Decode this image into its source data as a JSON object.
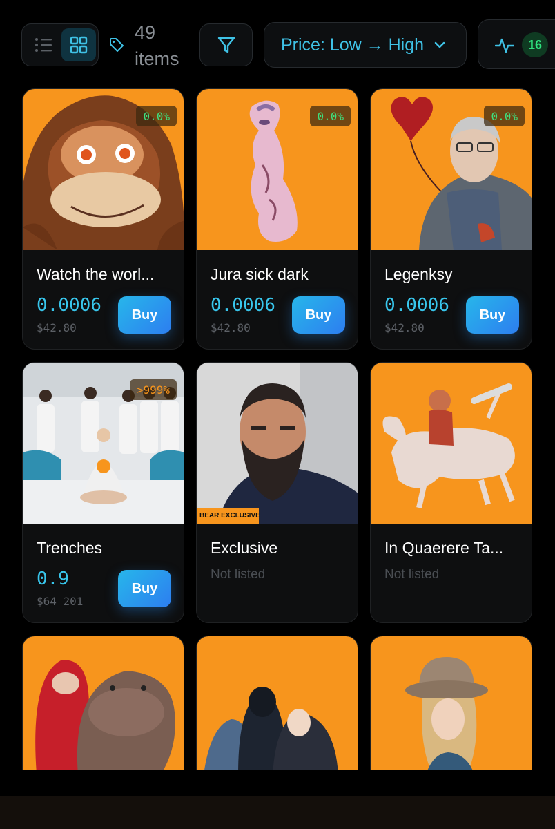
{
  "toolbar": {
    "count_number": "49",
    "count_unit": "items",
    "sort_label": "Price: Low → High",
    "activity_count": "16"
  },
  "colors": {
    "accent": "#3fc2e6",
    "card_art_bg": "#f7951d",
    "positive": "#3ee07e",
    "buy_gradient_start": "#27b6ea",
    "buy_gradient_end": "#2d7ef0"
  },
  "cards": [
    {
      "name": "Watch the worl...",
      "change": "0.0%",
      "price": "0.0006",
      "usd": "$42.80",
      "buy": "Buy",
      "art": "orange ape face"
    },
    {
      "name": "Jura sick dark",
      "change": "0.0%",
      "price": "0.0006",
      "usd": "$42.80",
      "buy": "Buy",
      "art": "pink figure"
    },
    {
      "name": "Legenksy",
      "change": "0.0%",
      "price": "0.0006",
      "usd": "$42.80",
      "buy": "Buy",
      "art": "man with heart balloon"
    },
    {
      "name": "Trenches",
      "change": ">999%",
      "price": "0.9",
      "usd": "$64 201",
      "buy": "Buy",
      "art": "meditating figure with group"
    },
    {
      "name": "Exclusive",
      "status": "Not listed",
      "art": "bearded man",
      "art_label": "BEAR EXCLUSIVE"
    },
    {
      "name": "In Quaerere Ta...",
      "status": "Not listed",
      "art": "rider on horse"
    },
    {
      "art": "hooded figure with hippo"
    },
    {
      "art": "masked figures"
    },
    {
      "art": "woman in cowboy hat"
    }
  ]
}
